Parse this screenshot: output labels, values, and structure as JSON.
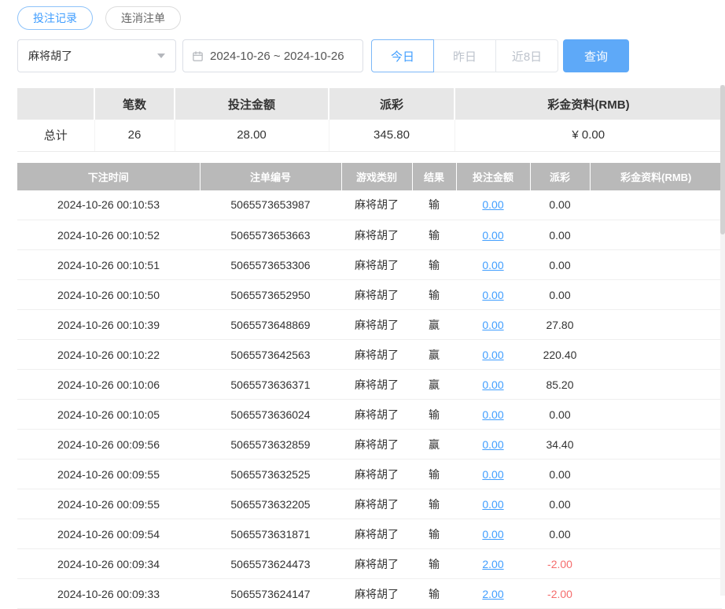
{
  "tabs": {
    "records": "投注记录",
    "cancelled": "连消注单"
  },
  "filters": {
    "game_select_value": "麻将胡了",
    "date_range": "2024-10-26 ~ 2024-10-26",
    "today": "今日",
    "yesterday": "昨日",
    "last8days": "近8日",
    "query": "查询"
  },
  "summary": {
    "headers": [
      "笔数",
      "投注金额",
      "派彩",
      "彩金资料(RMB)"
    ],
    "total_label": "总计",
    "count": "26",
    "bet_amount": "28.00",
    "payout": "345.80",
    "bonus": "¥ 0.00"
  },
  "table": {
    "headers": [
      "下注时间",
      "注单编号",
      "游戏类别",
      "结果",
      "投注金额",
      "派彩",
      "彩金资料(RMB)"
    ],
    "rows": [
      {
        "time": "2024-10-26 00:10:53",
        "order_id": "5065573653987",
        "game": "麻将胡了",
        "result": "输",
        "bet": "0.00",
        "payout": "0.00",
        "bonus": ""
      },
      {
        "time": "2024-10-26 00:10:52",
        "order_id": "5065573653663",
        "game": "麻将胡了",
        "result": "输",
        "bet": "0.00",
        "payout": "0.00",
        "bonus": ""
      },
      {
        "time": "2024-10-26 00:10:51",
        "order_id": "5065573653306",
        "game": "麻将胡了",
        "result": "输",
        "bet": "0.00",
        "payout": "0.00",
        "bonus": ""
      },
      {
        "time": "2024-10-26 00:10:50",
        "order_id": "5065573652950",
        "game": "麻将胡了",
        "result": "输",
        "bet": "0.00",
        "payout": "0.00",
        "bonus": ""
      },
      {
        "time": "2024-10-26 00:10:39",
        "order_id": "5065573648869",
        "game": "麻将胡了",
        "result": "赢",
        "bet": "0.00",
        "payout": "27.80",
        "bonus": ""
      },
      {
        "time": "2024-10-26 00:10:22",
        "order_id": "5065573642563",
        "game": "麻将胡了",
        "result": "赢",
        "bet": "0.00",
        "payout": "220.40",
        "bonus": ""
      },
      {
        "time": "2024-10-26 00:10:06",
        "order_id": "5065573636371",
        "game": "麻将胡了",
        "result": "赢",
        "bet": "0.00",
        "payout": "85.20",
        "bonus": ""
      },
      {
        "time": "2024-10-26 00:10:05",
        "order_id": "5065573636024",
        "game": "麻将胡了",
        "result": "输",
        "bet": "0.00",
        "payout": "0.00",
        "bonus": ""
      },
      {
        "time": "2024-10-26 00:09:56",
        "order_id": "5065573632859",
        "game": "麻将胡了",
        "result": "赢",
        "bet": "0.00",
        "payout": "34.40",
        "bonus": ""
      },
      {
        "time": "2024-10-26 00:09:55",
        "order_id": "5065573632525",
        "game": "麻将胡了",
        "result": "输",
        "bet": "0.00",
        "payout": "0.00",
        "bonus": ""
      },
      {
        "time": "2024-10-26 00:09:55",
        "order_id": "5065573632205",
        "game": "麻将胡了",
        "result": "输",
        "bet": "0.00",
        "payout": "0.00",
        "bonus": ""
      },
      {
        "time": "2024-10-26 00:09:54",
        "order_id": "5065573631871",
        "game": "麻将胡了",
        "result": "输",
        "bet": "0.00",
        "payout": "0.00",
        "bonus": ""
      },
      {
        "time": "2024-10-26 00:09:34",
        "order_id": "5065573624473",
        "game": "麻将胡了",
        "result": "输",
        "bet": "2.00",
        "payout": "-2.00",
        "bonus": ""
      },
      {
        "time": "2024-10-26 00:09:33",
        "order_id": "5065573624147",
        "game": "麻将胡了",
        "result": "输",
        "bet": "2.00",
        "payout": "-2.00",
        "bonus": ""
      }
    ]
  },
  "colors": {
    "accent": "#409eff",
    "query_bg": "#5ea9f8",
    "negative": "#f56c6c",
    "table_header_bg": "#b9b9b9",
    "summary_header_bg": "#e7e7e7"
  }
}
